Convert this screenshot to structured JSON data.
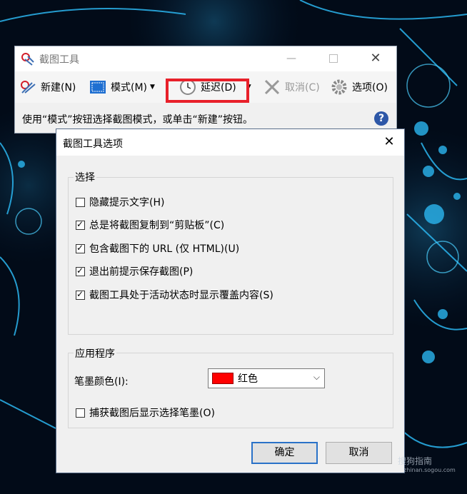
{
  "snipping_tool": {
    "title": "截图工具",
    "toolbar": {
      "new_label": "新建(N)",
      "mode_label": "模式(M)",
      "delay_label": "延迟(D)",
      "cancel_label": "取消(C)",
      "options_label": "选项(O)"
    },
    "hint": "使用“模式”按钮选择截图模式，或单击“新建”按钮。",
    "help": "?"
  },
  "options_dialog": {
    "title": "截图工具选项",
    "selection_group": {
      "label": "选择",
      "options": [
        {
          "label": "隐藏提示文字(H)",
          "checked": false
        },
        {
          "label": "总是将截图复制到“剪贴板”(C)",
          "checked": true
        },
        {
          "label": "包含截图下的 URL (仅 HTML)(U)",
          "checked": true
        },
        {
          "label": "退出前提示保存截图(P)",
          "checked": true
        },
        {
          "label": "截图工具处于活动状态时显示覆盖内容(S)",
          "checked": true
        }
      ]
    },
    "app_group": {
      "label": "应用程序",
      "pen_color_label": "笔墨颜色(I):",
      "pen_color_value": "红色",
      "pen_color_hex": "#ff0000",
      "show_pen_label": "捕获截图后显示选择笔墨(O)",
      "show_pen_checked": false
    },
    "ok_label": "确定",
    "cancel_label": "取消"
  },
  "watermark": {
    "text": "搜狗指南",
    "sub": "zhinan.sogou.com"
  },
  "colors": {
    "highlight": "#e8202a",
    "accent": "#2a72c8"
  }
}
